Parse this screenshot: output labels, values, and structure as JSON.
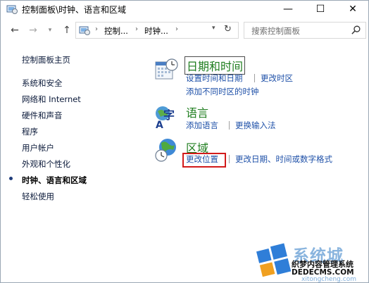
{
  "window": {
    "title": "控制面板\\时钟、语言和区域",
    "minimize_glyph": "—",
    "maximize_glyph": "☐",
    "close_glyph": "✕"
  },
  "nav": {
    "back_glyph": "←",
    "forward_glyph": "→",
    "recent_glyph": "▾",
    "up_glyph": "↑",
    "address": {
      "segments": [
        "控制...",
        "时钟..."
      ],
      "separator": "›",
      "dropdown_glyph": "▾",
      "refresh_glyph": "↻"
    },
    "search_placeholder": "搜索控制面板"
  },
  "sidebar": {
    "items": [
      {
        "label": "控制面板主页"
      },
      {
        "label": "系统和安全"
      },
      {
        "label": "网络和 Internet"
      },
      {
        "label": "硬件和声音"
      },
      {
        "label": "程序"
      },
      {
        "label": "用户帐户"
      },
      {
        "label": "外观和个性化"
      },
      {
        "label": "时钟、语言和区域",
        "current": true
      },
      {
        "label": "轻松使用"
      }
    ]
  },
  "categories": {
    "datetime": {
      "title": "日期和时间",
      "links": [
        "设置时间和日期",
        "更改时区",
        "添加不同时区的时钟"
      ]
    },
    "language": {
      "title": "语言",
      "links": [
        "添加语言",
        "更换输入法"
      ]
    },
    "region": {
      "title": "区域",
      "links": [
        "更改位置",
        "更改日期、时间或数字格式"
      ]
    }
  },
  "watermark": {
    "line1": "系统城",
    "line2": "织梦内容管理系统",
    "line3": "DEDECMS.COM",
    "line4": "xitongcheng.com"
  },
  "colors": {
    "link": "#1e50a8",
    "category_title": "#1e7d1e",
    "highlight": "#d21b1b"
  }
}
